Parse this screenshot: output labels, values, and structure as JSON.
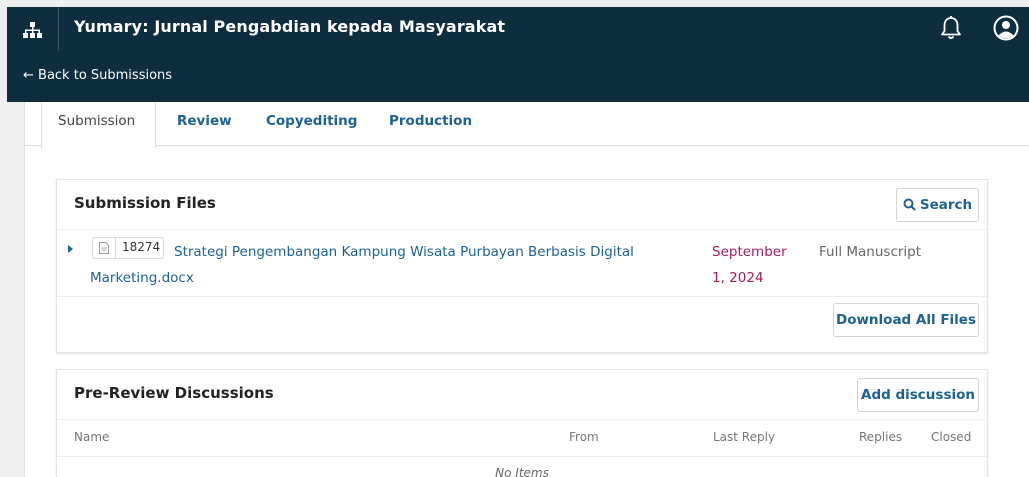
{
  "header": {
    "journal_title": "Yumary: Jurnal Pengabdian kepada Masyarakat",
    "back_link": "← Back to Submissions",
    "icons": [
      "sitemap-icon",
      "bell-icon",
      "user-account-icon"
    ]
  },
  "tabs": [
    {
      "label": "Submission",
      "active": true
    },
    {
      "label": "Review",
      "active": false
    },
    {
      "label": "Copyediting",
      "active": false
    },
    {
      "label": "Production",
      "active": false
    }
  ],
  "submission_files": {
    "title": "Submission Files",
    "search_label": "Search",
    "download_all_label": "Download All Files",
    "files": [
      {
        "id": "18274",
        "name": "Strategi  Pengembangan Kampung Wisata Purbayan Berbasis Digital Marketing.docx",
        "date": "September 1, 2024",
        "type": "Full Manuscript"
      }
    ]
  },
  "discussions": {
    "title": "Pre-Review Discussions",
    "add_label": "Add discussion",
    "columns": [
      "Name",
      "From",
      "Last Reply",
      "Replies",
      "Closed"
    ],
    "empty_text": "No Items"
  },
  "colors": {
    "header_bg": "#0e2d3e",
    "link": "#1e6292",
    "date": "#a31d5d"
  }
}
